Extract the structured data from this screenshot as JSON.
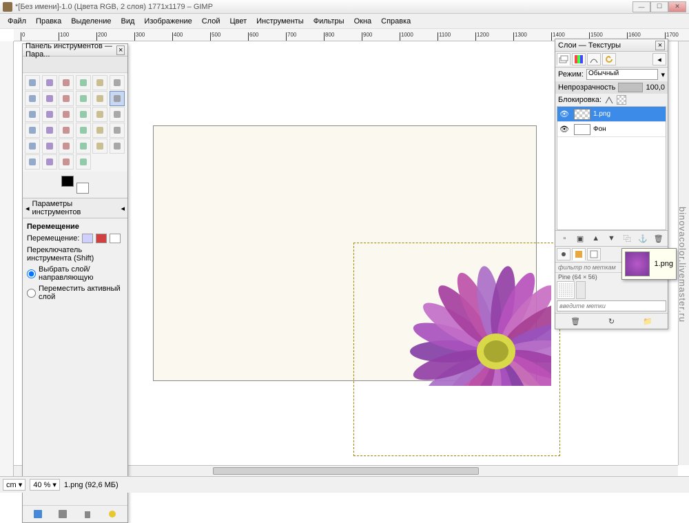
{
  "window": {
    "title": "*[Без имени]-1.0 (Цвета RGB, 2 слоя) 1771x1179 – GIMP"
  },
  "menu": {
    "items": [
      "Файл",
      "Правка",
      "Выделение",
      "Вид",
      "Изображение",
      "Слой",
      "Цвет",
      "Инструменты",
      "Фильтры",
      "Окна",
      "Справка"
    ]
  },
  "toolbox": {
    "title": "Панель инструментов — Пара...",
    "options_title": "Параметры инструментов",
    "move_heading": "Перемещение",
    "move_label": "Перемещение:",
    "switch_label": "Переключатель инструмента  (Shift)",
    "radio1": "Выбрать слой/направляющую",
    "radio2": "Переместить активный слой"
  },
  "layers": {
    "title": "Слои — Текстуры",
    "mode_label": "Режим:",
    "mode_value": "Обычный",
    "opacity_label": "Непрозрачность",
    "opacity_value": "100,0",
    "lock_label": "Блокировка:",
    "items": [
      {
        "name": "1.png",
        "selected": true,
        "checker": true
      },
      {
        "name": "Фон",
        "selected": false,
        "checker": false
      }
    ]
  },
  "textures": {
    "filter_label": "фильтр по меткам",
    "info": "Pine (64 × 56)",
    "input_placeholder": "введите метки",
    "tooltip": "1.png",
    "swatches": [
      "#3a2a1a",
      "#5a1818",
      "#d8a830",
      "#3a6a3a",
      "#2a5a7a",
      "#2a4a2a",
      "#284838",
      "#d0d0d0",
      "#b0b0b0",
      "#888888",
      "#606060",
      "#404040",
      "#f0f0f0",
      "#e8e8e8",
      "#907050",
      "#a06030",
      "#c88840",
      "#8a5a2a",
      "#6a4a2a",
      "#5a3a1a",
      "#d8d8d8",
      "#e8a840",
      "#c85838",
      "#d88850",
      "#4868a8",
      "#3858a8",
      "#5878c8",
      "#e0e0e0",
      "#6898c8",
      "#a0a0a0",
      "#888878",
      "#989888",
      "#606058",
      "#808078",
      "#f0f0f0",
      "#787870",
      "#686860",
      "#a89878",
      "#c8a850",
      "#000000",
      "#e8c830",
      "#ffffff",
      "#a87838",
      "#8a5a28",
      "#9a6a38",
      "#aa7a48",
      "#ba8a58",
      "#ca9a68",
      "#daa878"
    ]
  },
  "statusbar": {
    "unit": "cm",
    "zoom": "40 %",
    "file_info": "1.png (92,6 МБ)"
  },
  "watermark": "binovacolor.livemaster.ru",
  "ruler_ticks": [
    "0",
    "100",
    "200",
    "300",
    "400",
    "500",
    "600",
    "700",
    "800",
    "900",
    "1000",
    "1100",
    "1200",
    "1300",
    "1400",
    "1500",
    "1600",
    "1700"
  ]
}
